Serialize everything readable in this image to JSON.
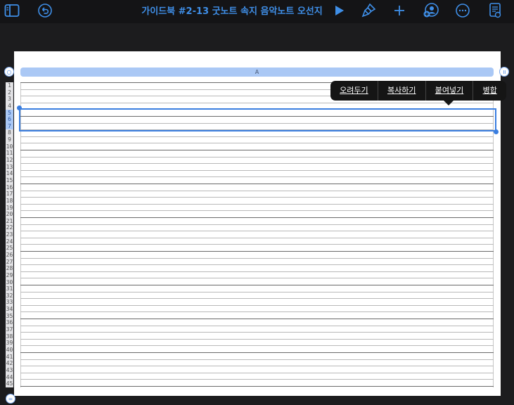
{
  "app": {
    "title": "가이드북 #2-13 굿노트 속지 음악노트 오선지",
    "accent_color": "#3f8fe8"
  },
  "toolbar": {
    "icons": [
      "sidebar-icon",
      "undo-icon",
      "play-icon",
      "paintbrush-icon",
      "plus-icon",
      "collaborate-icon",
      "more-icon",
      "document-icon"
    ]
  },
  "sheet": {
    "column_header": "A",
    "selected_rows": [
      5,
      6,
      7
    ],
    "row_numbers": [
      "1",
      "2",
      "3",
      "4",
      "5",
      "6",
      "7",
      "8",
      "9",
      "10",
      "11",
      "12",
      "13",
      "14",
      "15",
      "16",
      "17",
      "18",
      "19",
      "20",
      "21",
      "22",
      "23",
      "24",
      "25",
      "26",
      "27",
      "28",
      "29",
      "30",
      "31",
      "32",
      "33",
      "34",
      "35",
      "36",
      "37",
      "38",
      "39",
      "40",
      "41",
      "42",
      "43",
      "44",
      "45"
    ],
    "selection_color": "#3a7ee0",
    "header_color": "#aac8f5"
  },
  "context_menu": {
    "items": [
      "오려두기",
      "복사하기",
      "붙여넣기",
      "병합"
    ]
  },
  "controls": {
    "top_left_handle": "○",
    "top_right_handle": "॥",
    "bottom_left_handle": "="
  }
}
